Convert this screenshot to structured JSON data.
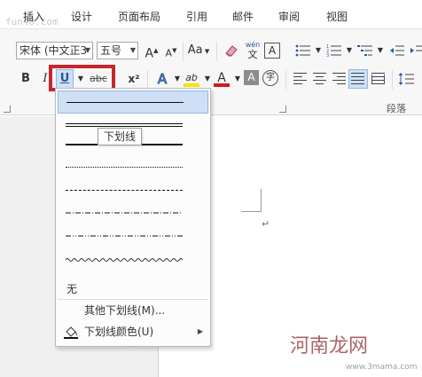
{
  "watermark_top": "fun48.com",
  "tabs": [
    {
      "label": "插入"
    },
    {
      "label": "设计"
    },
    {
      "label": "页面布局"
    },
    {
      "label": "引用"
    },
    {
      "label": "邮件"
    },
    {
      "label": "审阅"
    },
    {
      "label": "视图"
    }
  ],
  "font": {
    "name_value": "宋体 (中文正3",
    "size_value": "五号"
  },
  "buttons": {
    "grow_font": "A",
    "shrink_font": "A",
    "change_case": "Aa",
    "wen_top": "wén",
    "wen_bottom": "文",
    "char_border": "A",
    "bold": "B",
    "italic": "I",
    "underline": "U",
    "strikethrough": "abc",
    "superscript": "x²",
    "text_effects": "A",
    "highlight": "ab",
    "font_color": "A",
    "char_shading": "A",
    "enclose": "字"
  },
  "group_labels": {
    "paragraph": "段落"
  },
  "underline_menu": {
    "tooltip": "下划线",
    "none_label": "无",
    "more_label": "其他下划线(M)...",
    "color_label": "下划线颜色(U)",
    "grip": "....",
    "styles": [
      "single",
      "double",
      "thick",
      "dotted",
      "dashed",
      "dash-dot",
      "dash-dot-dot",
      "wave"
    ]
  },
  "watermark": {
    "logo": "河南龙网",
    "url": "www.3mama.com"
  },
  "colors": {
    "highlight_frame": "#c9252c",
    "selected_option": "#cfe0f6",
    "highlighter_yellow": "#f5e500",
    "font_color_red": "#d0191b",
    "accent_blue": "#2b5797"
  }
}
